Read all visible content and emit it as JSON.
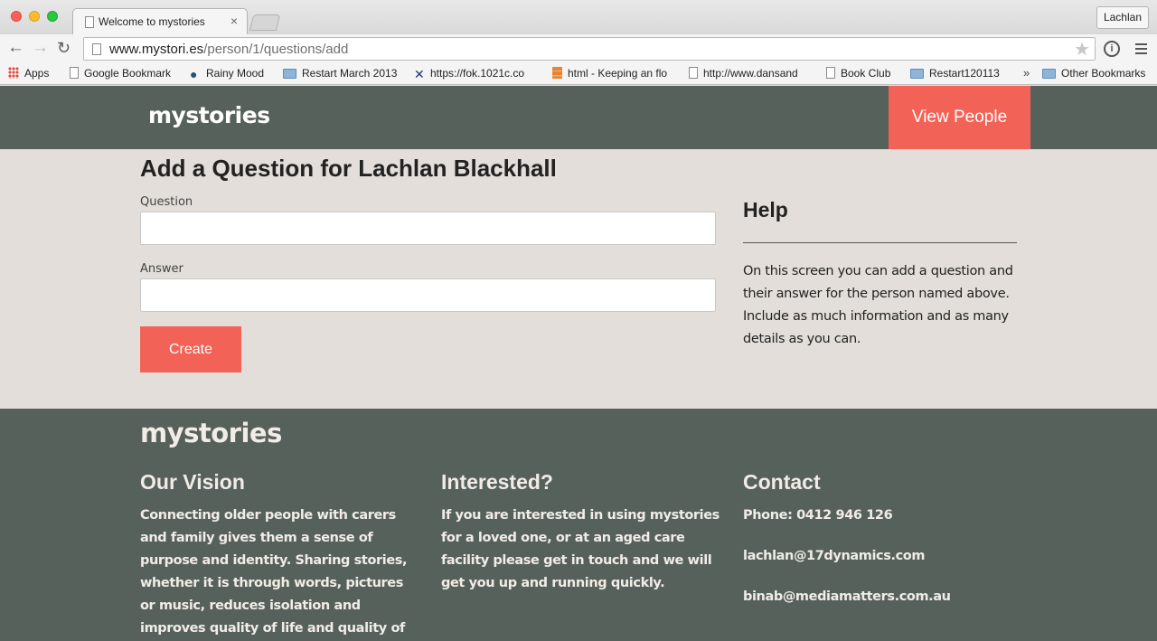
{
  "browser": {
    "tab_title": "Welcome to mystories",
    "tab_close": "×",
    "profile_name": "Lachlan",
    "url_domain": "www.mystori.es",
    "url_path": "/person/1/questions/add",
    "bookmarks": [
      {
        "label": "Apps",
        "icon": "apps-grid-icon"
      },
      {
        "label": "Google Bookmark",
        "icon": "page-icon"
      },
      {
        "label": "Rainy Mood",
        "icon": "raindrop-icon"
      },
      {
        "label": "Restart March 2013",
        "icon": "folder-icon"
      },
      {
        "label": "https://fok.1021c.co",
        "icon": "crossed-swords-icon"
      },
      {
        "label": "html - Keeping an flo",
        "icon": "stackoverflow-icon"
      },
      {
        "label": "http://www.dansand",
        "icon": "page-icon"
      },
      {
        "label": "Book Club",
        "icon": "page-icon"
      },
      {
        "label": "Restart120113",
        "icon": "folder-icon"
      }
    ],
    "bookmarks_more": "»",
    "other_bookmarks": "Other Bookmarks"
  },
  "header": {
    "logo": "mystories",
    "view_people": "View People"
  },
  "form": {
    "title": "Add a Question for Lachlan Blackhall",
    "question_label": "Question",
    "question_value": "",
    "answer_label": "Answer",
    "answer_value": "",
    "submit_label": "Create"
  },
  "help": {
    "title": "Help",
    "text": "On this screen you can add a question and their answer for the person named above. Include as much information and as many details as you can."
  },
  "footer": {
    "logo": "mystories",
    "vision_title": "Our Vision",
    "vision_text": "Connecting older people with carers and family gives them a sense of purpose and identity. Sharing stories, whether it is through words, pictures or music, reduces isolation and improves quality of life and quality of care.",
    "interested_title": "Interested?",
    "interested_text": "If you are interested in using mystories for a loved one, or at an aged care facility please get in touch and we will get you up and running quickly.",
    "contact_title": "Contact",
    "phone": "Phone: 0412 946 126",
    "email1": "lachlan@17dynamics.com",
    "email2": "binab@mediamatters.com.au"
  },
  "colors": {
    "accent": "#f26257",
    "header_bg": "#57615c",
    "page_bg": "#e3ded9"
  }
}
